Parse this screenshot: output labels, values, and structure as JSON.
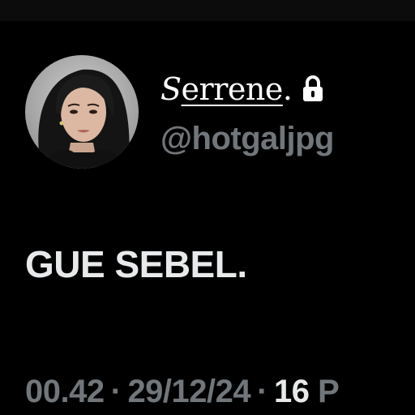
{
  "profile": {
    "display_name_first": "S",
    "display_name_rest": "errene",
    "display_name_end": ".",
    "handle": "@hotgaljpg",
    "protected_icon": "lock-icon"
  },
  "tweet": {
    "text": "GUE SEBEL."
  },
  "meta": {
    "time": "00.42",
    "separator": "·",
    "date": "29/12/24",
    "views_count": "16",
    "views_label_partial": "P"
  },
  "colors": {
    "background": "#000000",
    "primary_text": "#e7e9ea",
    "secondary_text": "#71767b"
  }
}
